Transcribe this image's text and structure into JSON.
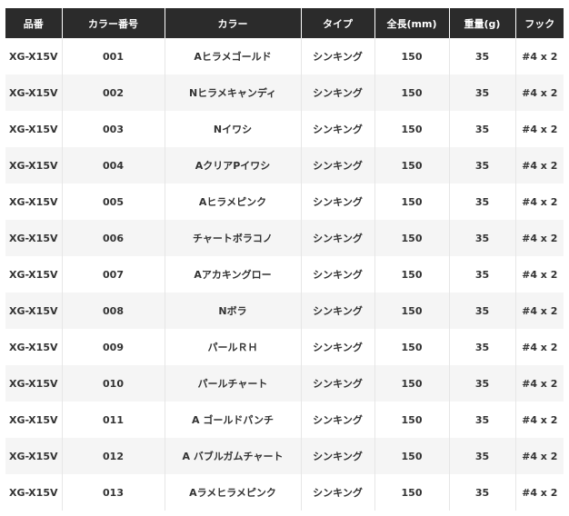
{
  "table": {
    "headers": [
      "品番",
      "カラー番号",
      "カラー",
      "タイプ",
      "全長(mm)",
      "重量(g)",
      "フック"
    ],
    "rows": [
      [
        "XG-X15V",
        "001",
        "Aヒラメゴールド",
        "シンキング",
        "150",
        "35",
        "#4 x 2"
      ],
      [
        "XG-X15V",
        "002",
        "Nヒラメキャンディ",
        "シンキング",
        "150",
        "35",
        "#4 x 2"
      ],
      [
        "XG-X15V",
        "003",
        "Nイワシ",
        "シンキング",
        "150",
        "35",
        "#4 x 2"
      ],
      [
        "XG-X15V",
        "004",
        "AクリアPイワシ",
        "シンキング",
        "150",
        "35",
        "#4 x 2"
      ],
      [
        "XG-X15V",
        "005",
        "Aヒラメピンク",
        "シンキング",
        "150",
        "35",
        "#4 x 2"
      ],
      [
        "XG-X15V",
        "006",
        "チャートボラコノ",
        "シンキング",
        "150",
        "35",
        "#4 x 2"
      ],
      [
        "XG-X15V",
        "007",
        "Aアカキングロー",
        "シンキング",
        "150",
        "35",
        "#4 x 2"
      ],
      [
        "XG-X15V",
        "008",
        "Nボラ",
        "シンキング",
        "150",
        "35",
        "#4 x 2"
      ],
      [
        "XG-X15V",
        "009",
        "パールＲＨ",
        "シンキング",
        "150",
        "35",
        "#4 x 2"
      ],
      [
        "XG-X15V",
        "010",
        "パールチャート",
        "シンキング",
        "150",
        "35",
        "#4 x 2"
      ],
      [
        "XG-X15V",
        "011",
        "A ゴールドパンチ",
        "シンキング",
        "150",
        "35",
        "#4 x 2"
      ],
      [
        "XG-X15V",
        "012",
        "A バブルガムチャート",
        "シンキング",
        "150",
        "35",
        "#4 x 2"
      ],
      [
        "XG-X15V",
        "013",
        "Aラメヒラメピンク",
        "シンキング",
        "150",
        "35",
        "#4 x 2"
      ]
    ]
  }
}
